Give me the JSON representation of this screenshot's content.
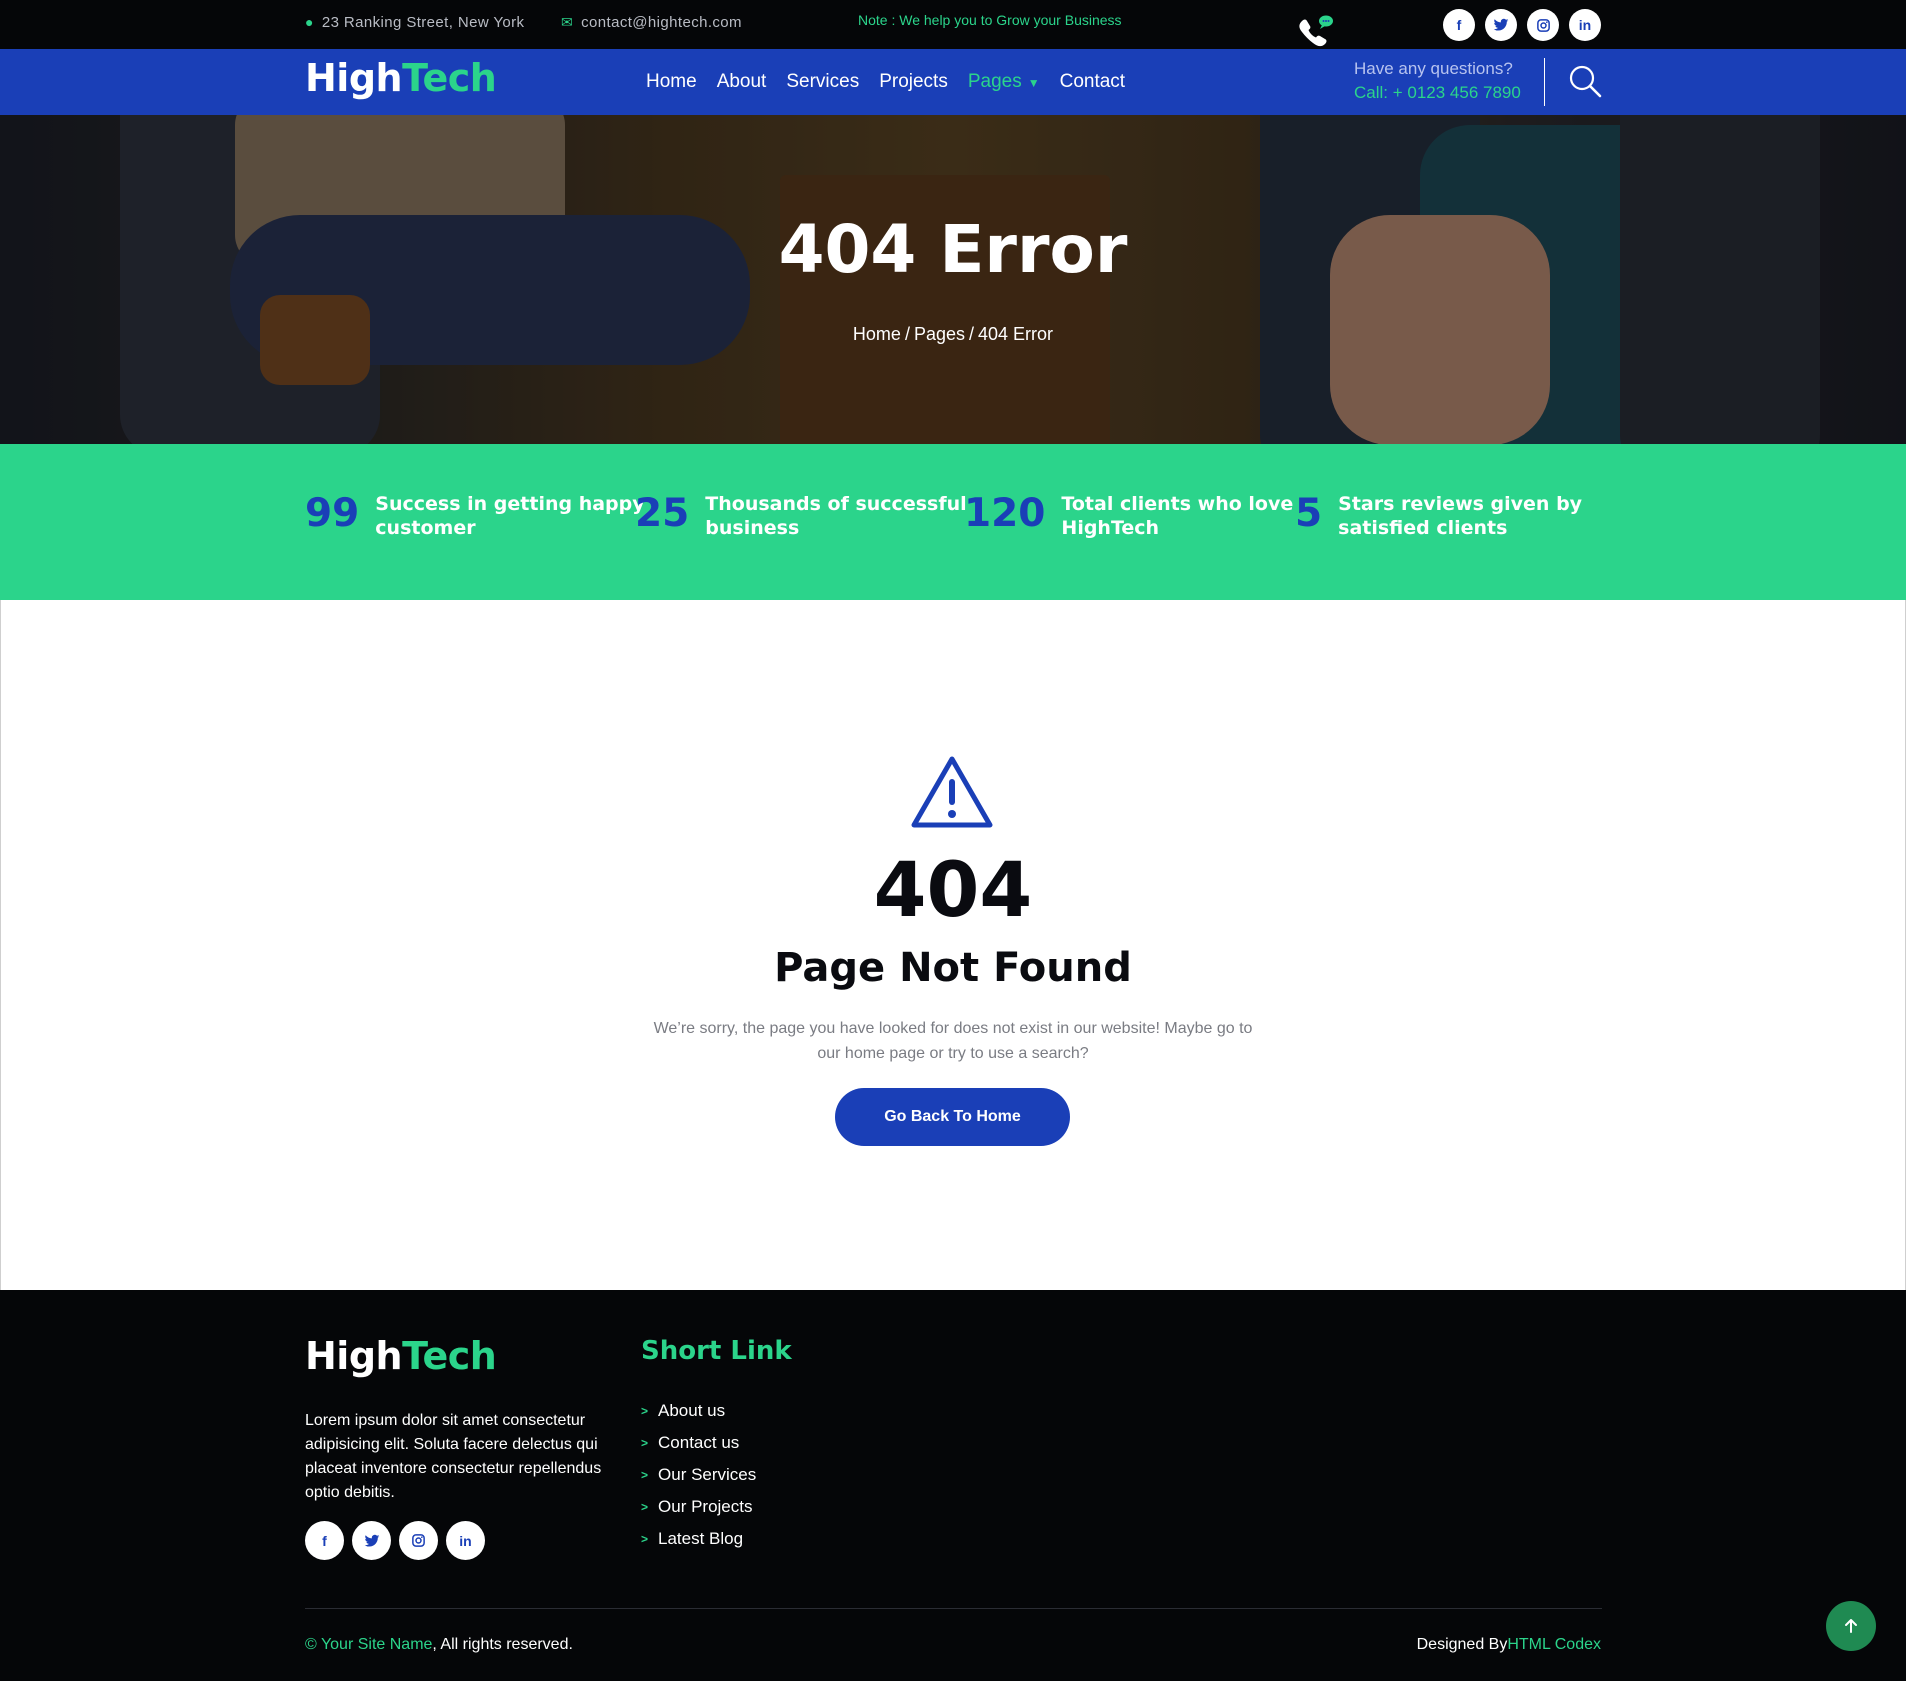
{
  "topbar": {
    "address": "23 Ranking Street, New York",
    "email": "contact@hightech.com",
    "note": "Note : We help you to Grow your Business",
    "social": [
      "f",
      "t",
      "ig",
      "in"
    ]
  },
  "brand": {
    "part1": "High",
    "part2": "Tech"
  },
  "nav": {
    "items": [
      "Home",
      "About",
      "Services",
      "Projects",
      "Pages",
      "Contact"
    ],
    "active": "Pages",
    "question": "Have any questions?",
    "phone": "Call: + 0123 456 7890"
  },
  "hero": {
    "title": "404 Error",
    "breadcrumb": [
      "Home",
      "Pages",
      "404 Error"
    ]
  },
  "stats": [
    {
      "number": "99",
      "line1": "Success in getting happy",
      "line2": "customer"
    },
    {
      "number": "25",
      "line1": "Thousands of successful",
      "line2": "business"
    },
    {
      "number": "120",
      "line1": "Total clients who love",
      "line2": "HighTech"
    },
    {
      "number": "5",
      "line1": "Stars reviews given by",
      "line2": "satisfied clients"
    }
  ],
  "error": {
    "code": "404",
    "heading": "Page Not Found",
    "message": "We’re sorry, the page you have looked for does not exist in our website! Maybe go to our home page or try to use a search?",
    "button": "Go Back To Home"
  },
  "footer": {
    "description": "Lorem ipsum dolor sit amet consectetur adipisicing elit. Soluta facere delectus qui placeat inventore consectetur repellendus optio debitis.",
    "short_link_title": "Short Link",
    "links": [
      "About us",
      "Contact us",
      "Our Services",
      "Our Projects",
      "Latest Blog"
    ],
    "copyright_site": "© Your Site Name",
    "copyright_rest": ", All rights reserved.",
    "designed_by": "Designed By",
    "designer": "HTML Codex"
  },
  "colors": {
    "brand_blue": "#1a3fb7",
    "brand_green": "#2bd48b",
    "dark": "#050608"
  }
}
